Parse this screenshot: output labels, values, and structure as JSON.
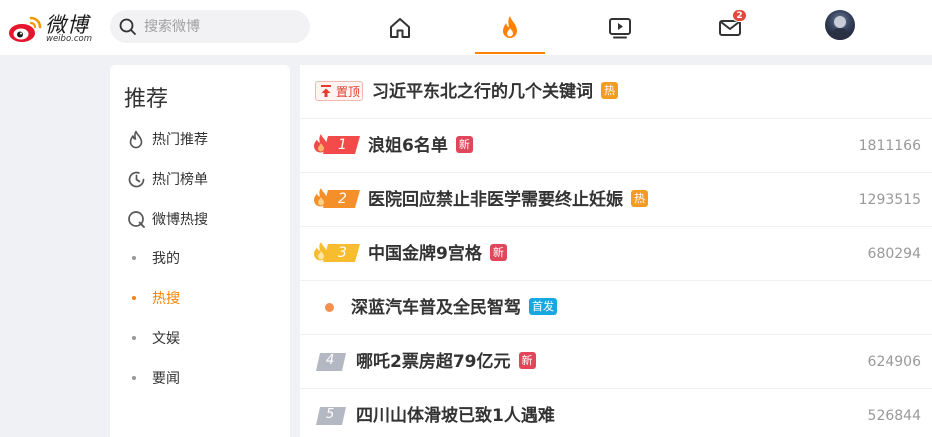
{
  "header": {
    "logo_text": "微博",
    "logo_domain": "weibo.com",
    "search_placeholder": "搜索微博",
    "nav": [
      "home-icon",
      "hot-flame-icon",
      "video-icon",
      "mail-icon"
    ],
    "mail_badge": "2",
    "accent": "#ff8200"
  },
  "sidebar": {
    "heading": "推荐",
    "items": [
      {
        "label": "热门推荐",
        "icon": "flame-outline-icon"
      },
      {
        "label": "热门榜单",
        "icon": "clock-icon"
      },
      {
        "label": "微博热搜",
        "icon": "search-loop-icon"
      }
    ],
    "sub_items": [
      {
        "label": "我的",
        "active": false
      },
      {
        "label": "热搜",
        "active": true
      },
      {
        "label": "文娱",
        "active": false
      },
      {
        "label": "要闻",
        "active": false
      }
    ]
  },
  "hot_list": {
    "pinned": {
      "badge": "置顶",
      "title": "习近平东北之行的几个关键词",
      "tag": "热"
    },
    "rows": [
      {
        "rank": "1",
        "title": "浪姐6名单",
        "tag": "新",
        "tag_type": "new",
        "count": "1811166"
      },
      {
        "rank": "2",
        "title": "医院回应禁止非医学需要终止妊娠",
        "tag": "热",
        "tag_type": "hot",
        "count": "1293515"
      },
      {
        "rank": "3",
        "title": "中国金牌9宫格",
        "tag": "新",
        "tag_type": "new",
        "count": "680294"
      },
      {
        "rank": "",
        "title": "深蓝汽车普及全民智驾",
        "tag": "首发",
        "tag_type": "first",
        "count": ""
      },
      {
        "rank": "4",
        "title": "哪吒2票房超79亿元",
        "tag": "新",
        "tag_type": "new",
        "count": "624906"
      },
      {
        "rank": "5",
        "title": "四川山体滑坡已致1人遇难",
        "tag": "",
        "tag_type": "",
        "count": "526844"
      }
    ]
  }
}
